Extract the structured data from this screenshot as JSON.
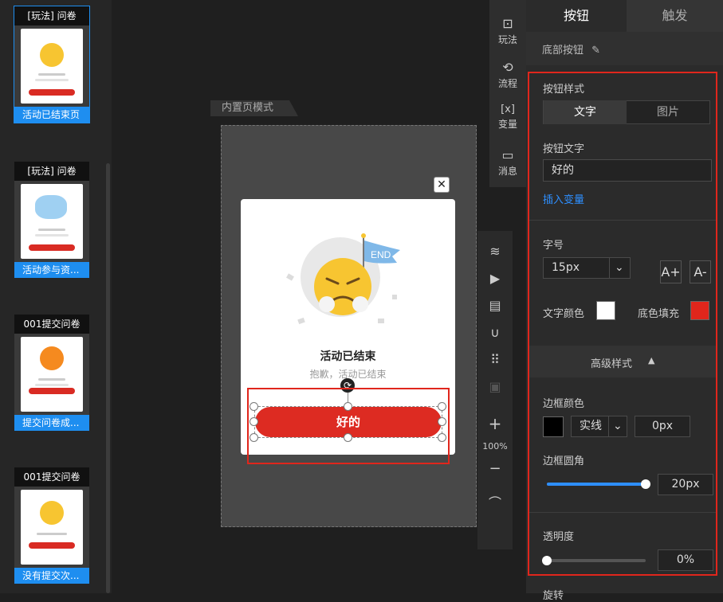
{
  "thumbs": [
    {
      "title": "[玩法] 问卷",
      "caption": "活动已结束页"
    },
    {
      "title": "[玩法] 问卷",
      "caption": "活动参与资..."
    },
    {
      "title": "001提交问卷",
      "caption": "提交问卷成..."
    },
    {
      "title": "001提交问卷",
      "caption": "没有提交次..."
    }
  ],
  "canvas": {
    "mode_tab": "内置页模式",
    "popup_title": "活动已结束",
    "popup_subtitle": "抱歉，活动已结束",
    "ok_button": "好的",
    "end_flag": "END",
    "close_icon": "✕",
    "rotate_icon": "⟳"
  },
  "menu": [
    {
      "label": "玩法",
      "icon": "⊡"
    },
    {
      "label": "流程",
      "icon": "⟲"
    },
    {
      "label": "变量",
      "icon": "[x]"
    },
    {
      "label": "消息",
      "icon": "▭"
    }
  ],
  "tools": {
    "zoom": "100%",
    "plus": "+",
    "minus": "−"
  },
  "panel": {
    "tabs": [
      "按钮",
      "触发"
    ],
    "section_title": "底部按钮",
    "button_style_label": "按钮样式",
    "style_options": [
      "文字",
      "图片"
    ],
    "button_text_label": "按钮文字",
    "button_text_value": "好的",
    "insert_variable": "插入变量",
    "font_size_label": "字号",
    "font_size_value": "15px",
    "font_up": "A+",
    "font_down": "A-",
    "text_color_label": "文字颜色",
    "bg_fill_label": "底色填充",
    "text_color": "#ffffff",
    "fill_color": "#e0261c",
    "advanced_label": "高级样式",
    "border_color_label": "边框颜色",
    "border_color": "#000000",
    "border_style": "实线",
    "border_width": "0px",
    "radius_label": "边框圆角",
    "radius_value": "20px",
    "radius_level": 1.0,
    "opacity_label": "透明度",
    "opacity_value": "0%",
    "opacity_level": 0,
    "rotate_label": "旋转"
  }
}
